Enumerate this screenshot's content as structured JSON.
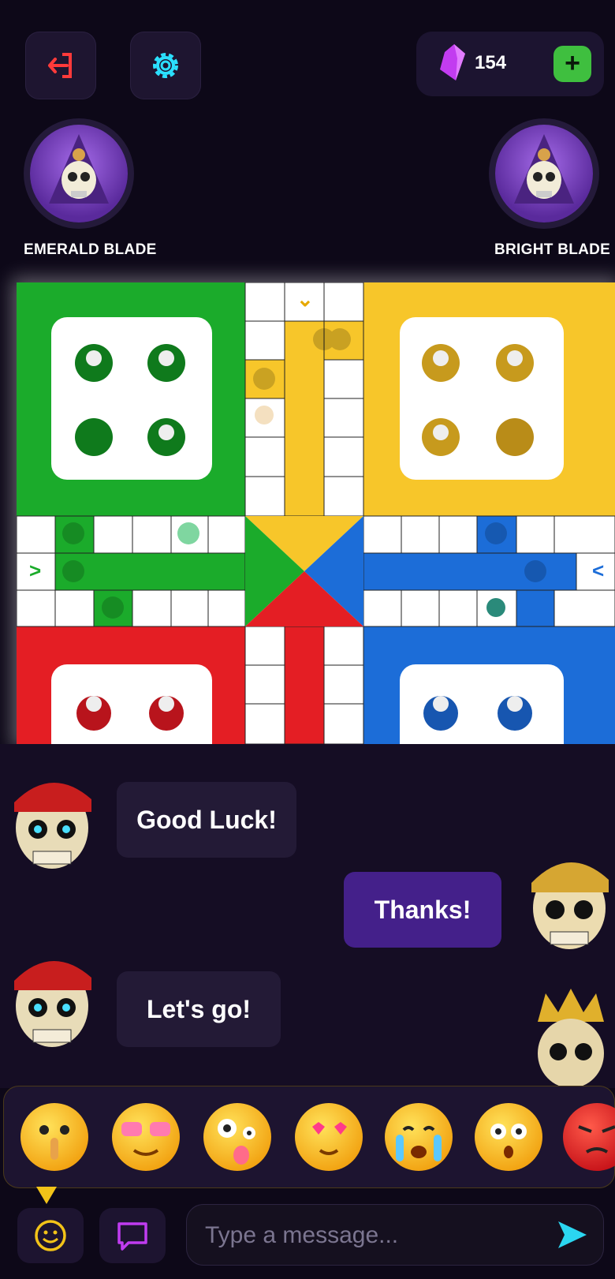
{
  "header": {
    "exit_icon": "exit-icon",
    "settings_icon": "gear-icon",
    "gem_icon": "gem-icon",
    "gem_count": "154",
    "add_label": "+"
  },
  "players": {
    "left": {
      "name": "EMERALD BLADE",
      "avatar": "hooded-skull-avatar"
    },
    "right": {
      "name": "BRIGHT BLADE",
      "avatar": "hooded-skull-avatar"
    }
  },
  "board": {
    "colors": {
      "green": "#1bab2b",
      "yellow": "#f7c62a",
      "red": "#e41e24",
      "blue": "#1c6dd8"
    },
    "arrow_up": "⌄",
    "arrow_left": ">",
    "arrow_right": "<"
  },
  "chat": {
    "messages": [
      {
        "text": "Good Luck!",
        "side": "left",
        "avatar": "red-bandana-skull"
      },
      {
        "text": "Thanks!",
        "side": "right",
        "avatar": "gold-bandana-skull"
      },
      {
        "text": "Let's go!",
        "side": "left",
        "avatar": "red-bandana-skull"
      }
    ],
    "crown_avatar": "crowned-skull"
  },
  "emojis": [
    "shush-face",
    "heart-glasses-face",
    "crazy-face",
    "heart-eyes-face",
    "crying-face",
    "surprised-face",
    "angry-face"
  ],
  "input": {
    "placeholder": "Type a message...",
    "emoji_button_icon": "smiley-icon",
    "chat_button_icon": "chat-bubble-icon",
    "send_icon": "send-icon"
  }
}
